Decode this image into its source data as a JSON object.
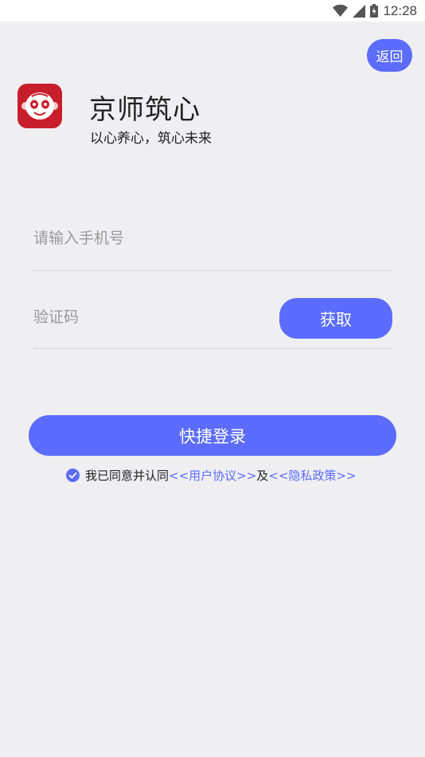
{
  "status_bar": {
    "time": "12:28"
  },
  "header": {
    "back_label": "返回"
  },
  "app": {
    "name": "京师筑心",
    "slogan": "以心养心，筑心未来"
  },
  "form": {
    "phone_placeholder": "请输入手机号",
    "code_placeholder": "验证码",
    "get_code_label": "获取",
    "login_label": "快捷登录"
  },
  "agreement": {
    "prefix": "我已同意并认同",
    "user_agreement": "<<用户协议>>",
    "and": "及",
    "privacy_policy": "<<隐私政策>>",
    "checked": true
  },
  "colors": {
    "accent": "#5b6cff",
    "background": "#efeff1",
    "logo_bg": "#c81e2c"
  }
}
